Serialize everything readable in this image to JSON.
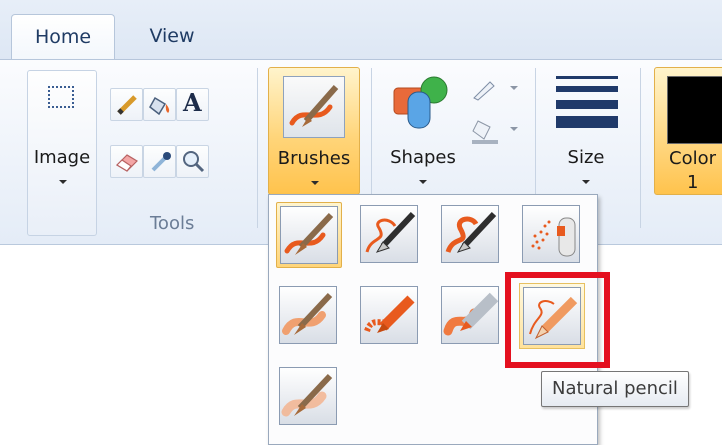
{
  "tabs": {
    "home": "Home",
    "view": "View"
  },
  "ribbon": {
    "image_label": "Image",
    "tools_label": "Tools",
    "brushes_label": "Brushes",
    "shapes_label": "Shapes",
    "size_label": "Size",
    "color_label_line1": "Color",
    "color_label_line2": "1",
    "color1_value": "#000000"
  },
  "brushes_menu": {
    "selected_index": 0,
    "hovered_index": 7,
    "items": [
      {
        "icon": "brush-icon"
      },
      {
        "icon": "calligraphy-brush-1-icon"
      },
      {
        "icon": "calligraphy-brush-2-icon"
      },
      {
        "icon": "airbrush-icon"
      },
      {
        "icon": "oil-brush-icon"
      },
      {
        "icon": "crayon-icon"
      },
      {
        "icon": "marker-icon"
      },
      {
        "icon": "natural-pencil-icon"
      },
      {
        "icon": "watercolor-brush-icon"
      }
    ]
  },
  "tooltip": {
    "text": "Natural pencil"
  },
  "colors": {
    "accent_orange": "#e85a1e",
    "highlight_red": "#e4101f",
    "selected_gold": "#ffc34d"
  }
}
